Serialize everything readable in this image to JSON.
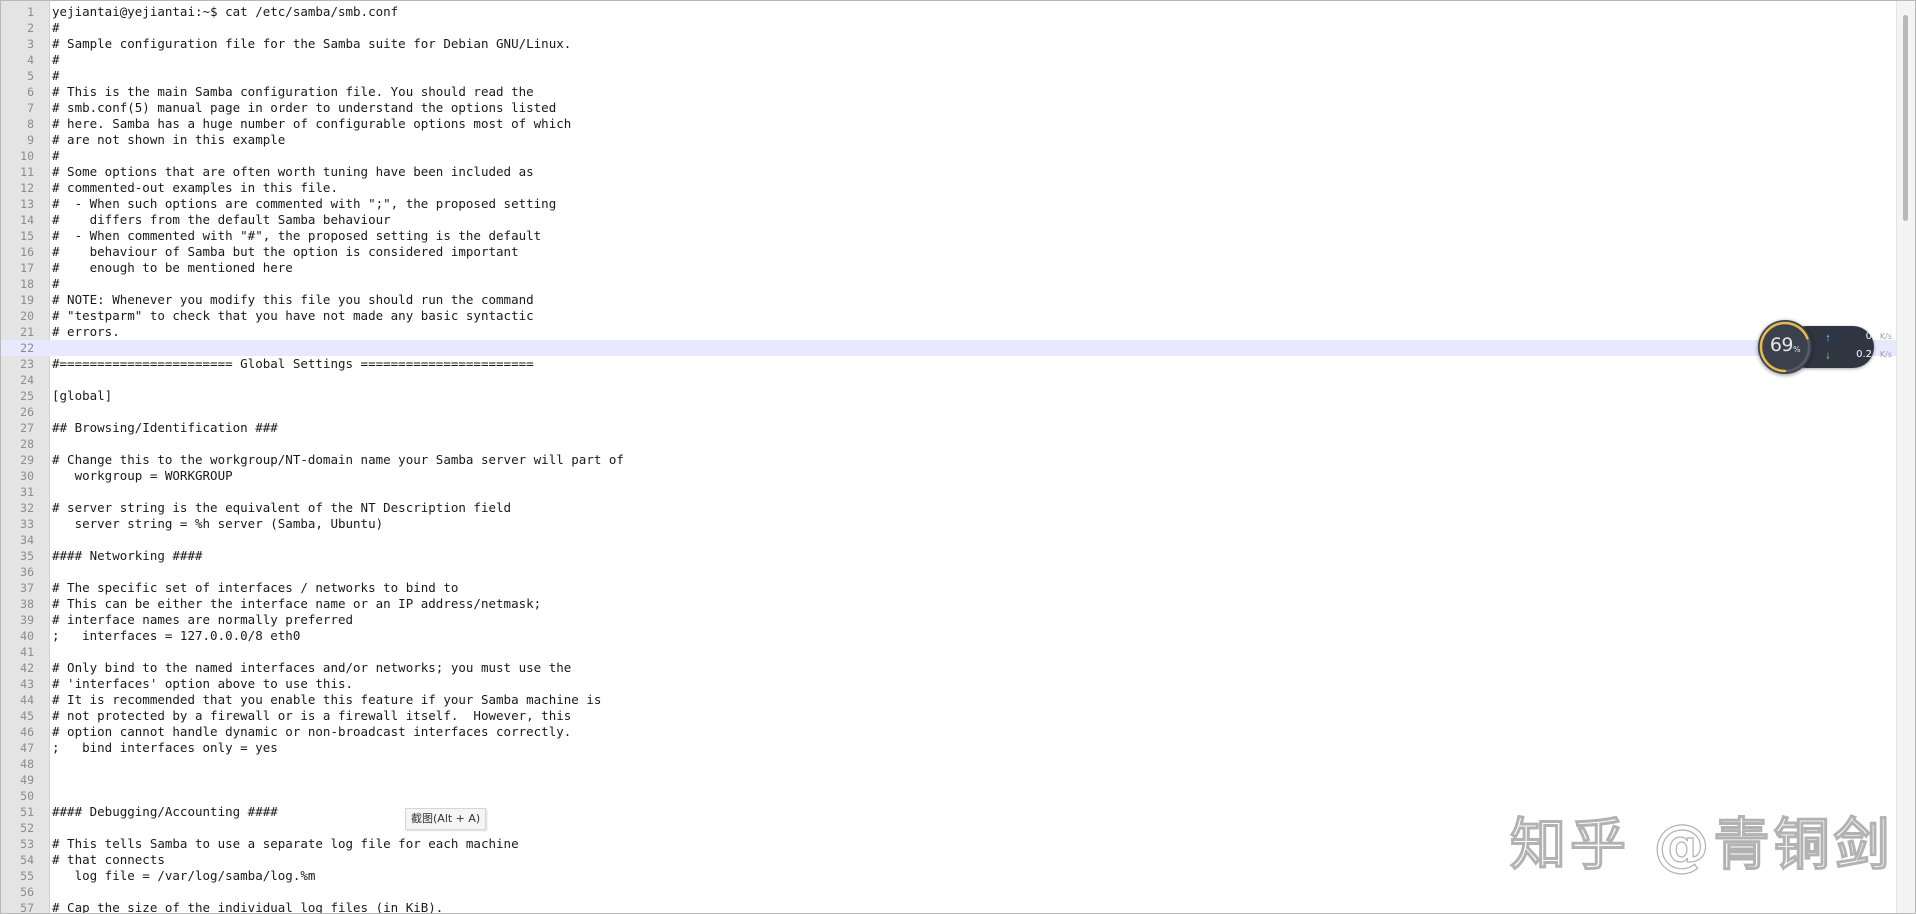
{
  "editor": {
    "current_line": 22,
    "lines": [
      "yejiantai@yejiantai:~$ cat /etc/samba/smb.conf",
      "#",
      "# Sample configuration file for the Samba suite for Debian GNU/Linux.",
      "#",
      "#",
      "# This is the main Samba configuration file. You should read the",
      "# smb.conf(5) manual page in order to understand the options listed",
      "# here. Samba has a huge number of configurable options most of which",
      "# are not shown in this example",
      "#",
      "# Some options that are often worth tuning have been included as",
      "# commented-out examples in this file.",
      "#  - When such options are commented with \";\", the proposed setting",
      "#    differs from the default Samba behaviour",
      "#  - When commented with \"#\", the proposed setting is the default",
      "#    behaviour of Samba but the option is considered important",
      "#    enough to be mentioned here",
      "#",
      "# NOTE: Whenever you modify this file you should run the command",
      "# \"testparm\" to check that you have not made any basic syntactic",
      "# errors.",
      "",
      "#======================= Global Settings =======================",
      "",
      "[global]",
      "",
      "## Browsing/Identification ###",
      "",
      "# Change this to the workgroup/NT-domain name your Samba server will part of",
      "   workgroup = WORKGROUP",
      "",
      "# server string is the equivalent of the NT Description field",
      "   server string = %h server (Samba, Ubuntu)",
      "",
      "#### Networking ####",
      "",
      "# The specific set of interfaces / networks to bind to",
      "# This can be either the interface name or an IP address/netmask;",
      "# interface names are normally preferred",
      ";   interfaces = 127.0.0.0/8 eth0",
      "",
      "# Only bind to the named interfaces and/or networks; you must use the",
      "# 'interfaces' option above to use this.",
      "# It is recommended that you enable this feature if your Samba machine is",
      "# not protected by a firewall or is a firewall itself.  However, this",
      "# option cannot handle dynamic or non-broadcast interfaces correctly.",
      ";   bind interfaces only = yes",
      "",
      "",
      "",
      "#### Debugging/Accounting ####",
      "",
      "# This tells Samba to use a separate log file for each machine",
      "# that connects",
      "   log file = /var/log/samba/log.%m",
      "",
      "# Cap the size of the individual log files (in KiB)."
    ]
  },
  "net_widget": {
    "percent": "69",
    "percent_sign": "%",
    "percent_value": 0.69,
    "ring_color": "#e8b84a",
    "upload_value": "0",
    "upload_unit": "K/s",
    "upload_arrow_color": "#4fa3e8",
    "download_value": "0.2",
    "download_unit": "K/s",
    "download_arrow_color": "#3fbf5a"
  },
  "tooltip": {
    "text": "截图(Alt + A)"
  },
  "watermark": {
    "text": "知乎 @青铜剑"
  }
}
